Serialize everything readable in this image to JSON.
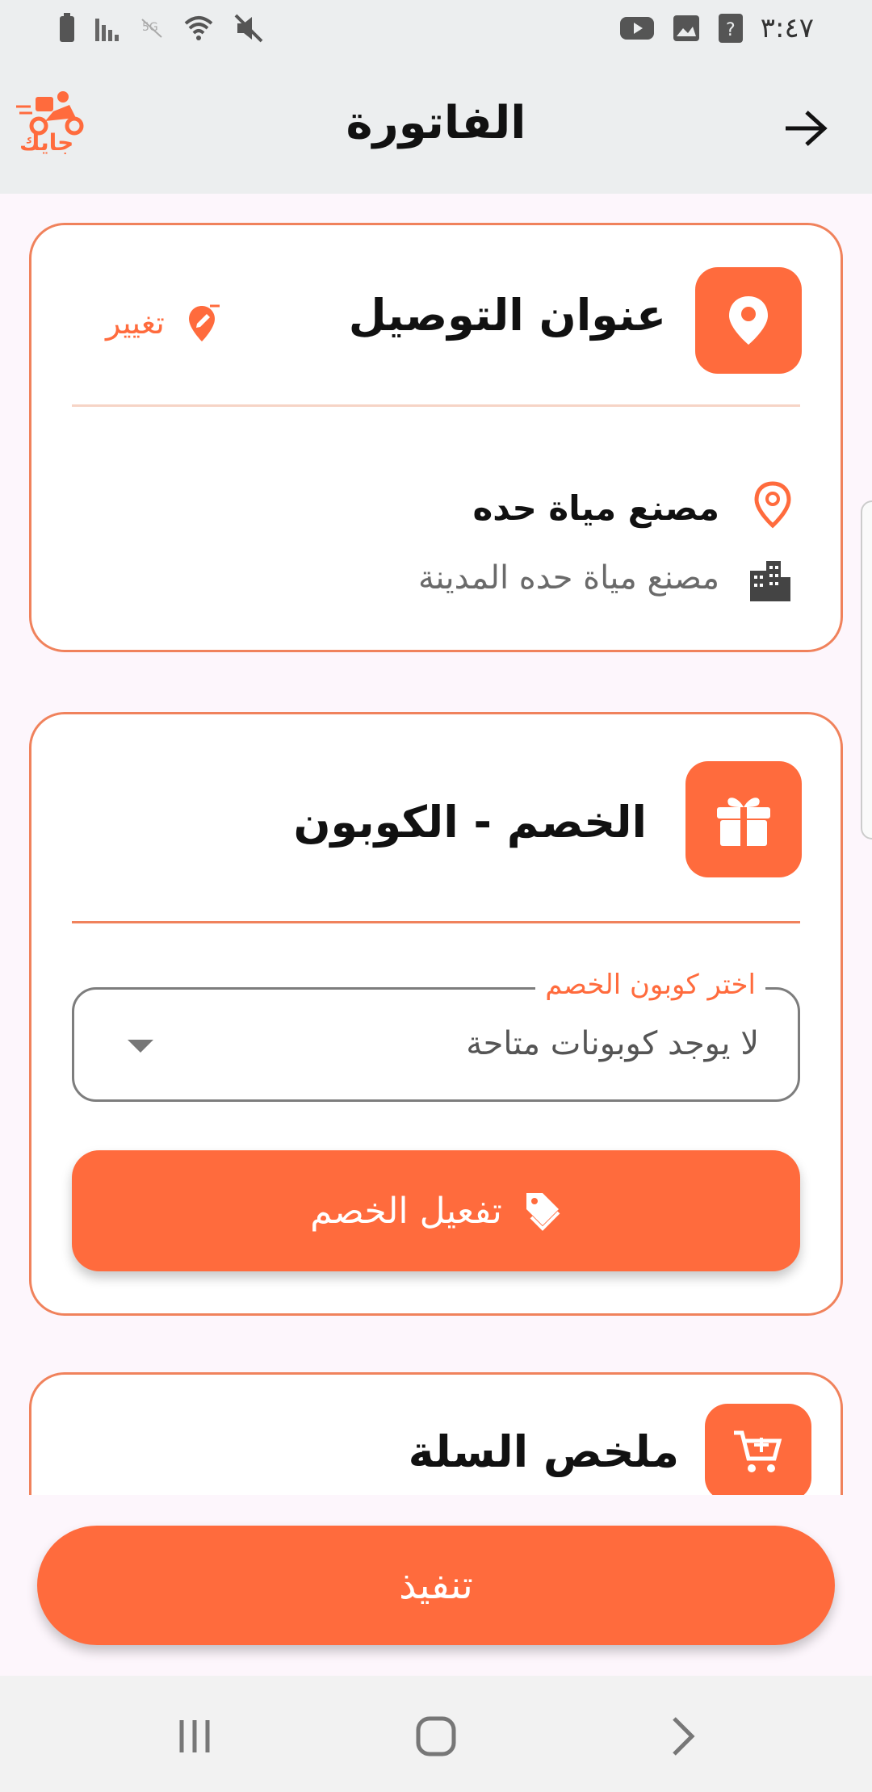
{
  "status_bar": {
    "time": "٣:٤٧"
  },
  "header": {
    "title": "الفاتورة",
    "logo_text": "جايك"
  },
  "address_card": {
    "title": "عنوان التوصيل",
    "change_label": "تغيير",
    "address_name": "مصنع مياة حده",
    "address_detail": "مصنع مياة حده المدينة"
  },
  "coupon_card": {
    "title": "الخصم - الكوبون",
    "select_label": "اختر كوبون الخصم",
    "select_value": "لا يوجد كوبونات متاحة",
    "activate_label": "تفعيل الخصم"
  },
  "cart_card": {
    "title": "ملخص السلة"
  },
  "footer": {
    "execute_label": "تنفيذ"
  },
  "colors": {
    "accent": "#ff6b3d",
    "card_border": "#f0825c",
    "background": "#fdf6fc",
    "bar": "#eceeef"
  },
  "icons": {
    "location": "location-pin-icon",
    "edit": "edit-pin-icon",
    "city": "city-buildings-icon",
    "gift": "gift-icon",
    "tag": "tag-icon",
    "cart": "add-to-cart-icon",
    "back": "arrow-right-icon"
  }
}
